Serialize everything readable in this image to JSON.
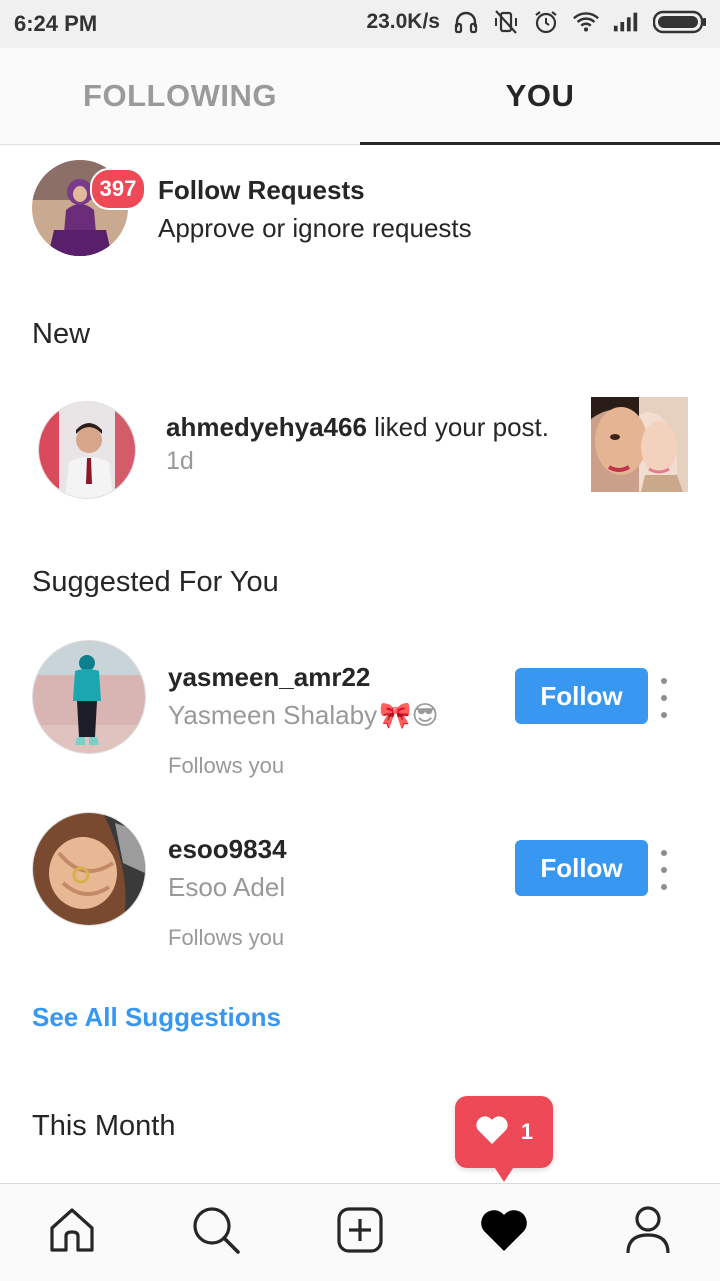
{
  "status_bar": {
    "time": "6:24 PM",
    "net_speed": "23.0K/s",
    "icons": [
      "headphones-icon",
      "vibrate-off-icon",
      "alarm-icon",
      "wifi-icon",
      "signal-icon",
      "battery-icon"
    ]
  },
  "tabs": [
    {
      "label": "FOLLOWING",
      "active": false
    },
    {
      "label": "YOU",
      "active": true
    }
  ],
  "follow_requests": {
    "badge_count": "397",
    "title": "Follow Requests",
    "subtitle": "Approve or ignore requests"
  },
  "sections": {
    "new": "New",
    "suggested": "Suggested For You",
    "this_month": "This Month"
  },
  "activity": [
    {
      "username": "ahmedyehya466",
      "action": " liked your post.",
      "time": "1d"
    }
  ],
  "suggestions": [
    {
      "username": "yasmeen_amr22",
      "name": "Yasmeen Shalaby",
      "name_emoji": "🎀😎",
      "meta": "Follows you",
      "button": "Follow"
    },
    {
      "username": "esoo9834",
      "name": "Esoo Adel",
      "name_emoji": "",
      "meta": "Follows you",
      "button": "Follow"
    }
  ],
  "see_all_label": "See All Suggestions",
  "notification": {
    "count": "1"
  },
  "bottom_nav": [
    "home-icon",
    "search-icon",
    "add-post-icon",
    "heart-icon",
    "profile-icon"
  ],
  "colors": {
    "accent": "#3897f0",
    "badge": "#ed4956",
    "text": "#262626",
    "muted": "#999999"
  }
}
